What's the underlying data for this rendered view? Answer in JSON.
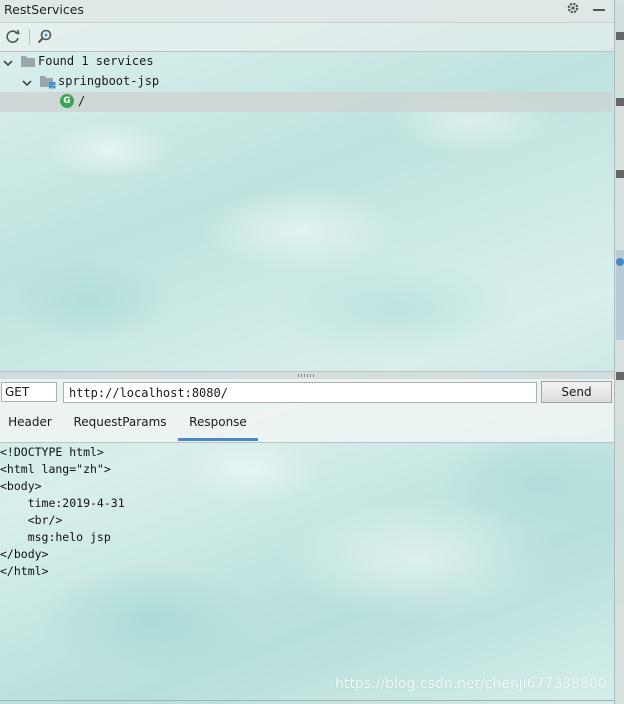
{
  "window": {
    "title": "RestServices",
    "settings_icon": "gear-icon",
    "minimize_icon": "minimize-icon"
  },
  "toolbar": {
    "refresh_icon": "refresh-icon",
    "search_icon": "search-icon"
  },
  "tree": {
    "root": {
      "label": "Found 1 services",
      "expanded": true
    },
    "module": {
      "label": "springboot-jsp",
      "expanded": true
    },
    "endpoint": {
      "method_badge": "G",
      "label": "/",
      "selected": true
    }
  },
  "request": {
    "method": "GET",
    "url": "http://localhost:8080/",
    "send_label": "Send"
  },
  "tabs": [
    {
      "label": "Header",
      "active": false
    },
    {
      "label": "RequestParams",
      "active": false
    },
    {
      "label": "Response",
      "active": true
    }
  ],
  "response": {
    "lines": [
      "<!DOCTYPE html>",
      "<html lang=\"zh\">",
      "<body>",
      "    time:2019-4-31",
      "    <br/>",
      "    msg:helo jsp",
      "</body>",
      "</html>"
    ]
  },
  "watermark": "https://blog.csdn.net/chenji677338800",
  "colors": {
    "active_tab": "#4a88c7",
    "method_badge": "#3aa655"
  }
}
